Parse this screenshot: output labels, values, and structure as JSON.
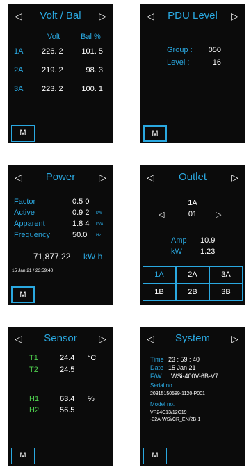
{
  "nav": {
    "prev_icon": "◁",
    "next_icon": "▷",
    "menu_label": "M"
  },
  "volt_bal": {
    "title": "Volt / Bal",
    "col_volt": "Volt",
    "col_bal": "Bal %",
    "rows": [
      {
        "label": "1A",
        "volt": "226. 2",
        "bal": "101. 5"
      },
      {
        "label": "2A",
        "volt": "219. 2",
        "bal": "98. 3"
      },
      {
        "label": "3A",
        "volt": "223. 2",
        "bal": "100. 1"
      }
    ]
  },
  "pdu_level": {
    "title": "PDU Level",
    "group_label": "Group :",
    "group_value": "050",
    "level_label": "Level :",
    "level_value": "16"
  },
  "power": {
    "title": "Power",
    "rows": [
      {
        "label": "Factor",
        "value": "0.5 0",
        "unit": ""
      },
      {
        "label": "Active",
        "value": "0.9 2",
        "unit": "kW"
      },
      {
        "label": "Apparent",
        "value": "1.8 4",
        "unit": "kVA"
      },
      {
        "label": "Frequency",
        "value": "50.0",
        "unit": "Hz"
      }
    ],
    "energy_value": "71,877.22",
    "energy_unit": "kW h",
    "datetime": "15 Jan 21 / 23:59:40"
  },
  "outlet": {
    "title": "Outlet",
    "bank": "1A",
    "outlet_no": "01",
    "left_icon": "◁",
    "right_icon": "▷",
    "amp_label": "Amp",
    "amp_value": "10.9",
    "kw_label": "kW",
    "kw_value": "1.23",
    "buttons": [
      "1A",
      "2A",
      "3A",
      "1B",
      "2B",
      "3B"
    ]
  },
  "sensor": {
    "title": "Sensor",
    "temps": [
      {
        "label": "T1",
        "value": "24.4",
        "unit": "°C"
      },
      {
        "label": "T2",
        "value": "24.5",
        "unit": ""
      }
    ],
    "hums": [
      {
        "label": "H1",
        "value": "63.4",
        "unit": "%"
      },
      {
        "label": "H2",
        "value": "56.5",
        "unit": ""
      }
    ]
  },
  "system": {
    "title": "System",
    "time_label": "Time",
    "time_value": "23 : 59 : 40",
    "date_label": "Date",
    "date_value": "15 Jan 21",
    "fw_label": "F/W",
    "fw_value": "WSi-400V-6B-V7",
    "serial_label": "Serial no.",
    "serial_value": "20315150589-1120-P001",
    "model_label": "Model no.",
    "model_line1": "VP24C13/12C19",
    "model_line2": "-32A-WSi/CR_EN/2B-1"
  },
  "colors": {
    "accent": "#2aa8e0",
    "background": "#0b0b0b",
    "text": "#ffffff",
    "sensor_label": "#4fd14f"
  }
}
